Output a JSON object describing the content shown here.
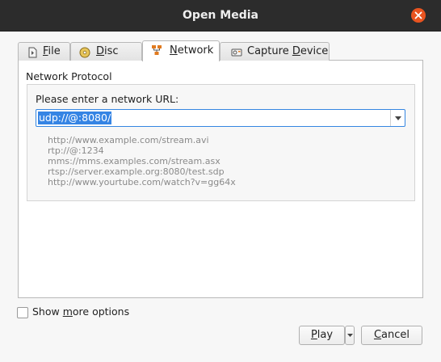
{
  "window": {
    "title": "Open Media"
  },
  "tabs": [
    {
      "pre": "",
      "mnemonic": "F",
      "post": "ile",
      "icon": "file-icon"
    },
    {
      "pre": "",
      "mnemonic": "D",
      "post": "isc",
      "icon": "disc-icon"
    },
    {
      "pre": "",
      "mnemonic": "N",
      "post": "etwork",
      "icon": "network-icon"
    },
    {
      "pre": "Capture ",
      "mnemonic": "D",
      "post": "evice",
      "icon": "capture-device-icon"
    }
  ],
  "active_tab": "Network",
  "network": {
    "section_label": "Network Protocol",
    "prompt": "Please enter a network URL:",
    "url_value": "udp://@:8080/",
    "examples": [
      "http://www.example.com/stream.avi",
      "rtp://@:1234",
      "mms://mms.examples.com/stream.asx",
      "rtsp://server.example.org:8080/test.sdp",
      "http://www.yourtube.com/watch?v=gg64x"
    ]
  },
  "options": {
    "show_more_pre": "Show ",
    "show_more_mnemonic": "m",
    "show_more_post": "ore options",
    "checked": false
  },
  "buttons": {
    "play_mnemonic": "P",
    "play_rest": "lay",
    "cancel_mnemonic": "C",
    "cancel_rest": "ancel"
  },
  "colors": {
    "titlebar": "#2c2c2c",
    "close": "#e95420",
    "selection": "#3584e4"
  }
}
